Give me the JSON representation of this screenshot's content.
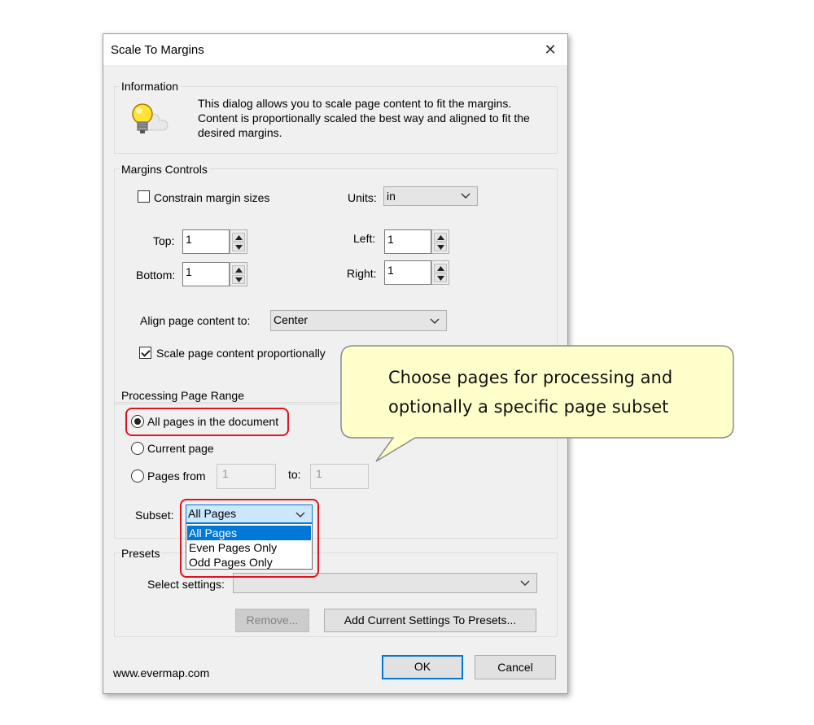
{
  "dialog": {
    "title": "Scale To Margins",
    "close_glyph": "✕",
    "footer_link": "www.evermap.com"
  },
  "information": {
    "label": "Information",
    "icon": "lightbulb-icon",
    "text_lines": [
      "This dialog allows you to scale page content to fit the margins.",
      "Content is proportionally scaled the best way and aligned to fit the",
      "desired margins."
    ]
  },
  "margins": {
    "label": "Margins Controls",
    "constrain_label": "Constrain margin sizes",
    "constrain_checked": false,
    "units_label": "Units:",
    "units_value": "in",
    "top_label": "Top:",
    "top_value": "1",
    "bottom_label": "Bottom:",
    "bottom_value": "1",
    "left_label": "Left:",
    "left_value": "1",
    "right_label": "Right:",
    "right_value": "1",
    "align_label": "Align page content to:",
    "align_value": "Center",
    "scale_label": "Scale page content proportionally",
    "scale_checked": true
  },
  "range": {
    "label": "Processing Page Range",
    "all_pages_label": "All pages in the document",
    "current_page_label": "Current page",
    "pages_from_label": "Pages from",
    "from_value": "1",
    "to_label": "to:",
    "to_value": "1",
    "selected": "all_pages",
    "subset_label": "Subset:",
    "subset_value": "All Pages",
    "subset_options": [
      "All Pages",
      "Even Pages Only",
      "Odd Pages Only"
    ]
  },
  "presets": {
    "label": "Presets",
    "select_label": "Select settings:",
    "select_value": "",
    "remove_button": "Remove...",
    "add_button": "Add Current Settings To Presets..."
  },
  "buttons": {
    "ok": "OK",
    "cancel": "Cancel"
  },
  "callout": {
    "line1": "Choose pages for processing and",
    "line2": "optionally a specific page subset"
  },
  "colors": {
    "highlight_box": "#e0141e",
    "callout_fill": "#ffffcc",
    "accent": "#0078d7"
  }
}
